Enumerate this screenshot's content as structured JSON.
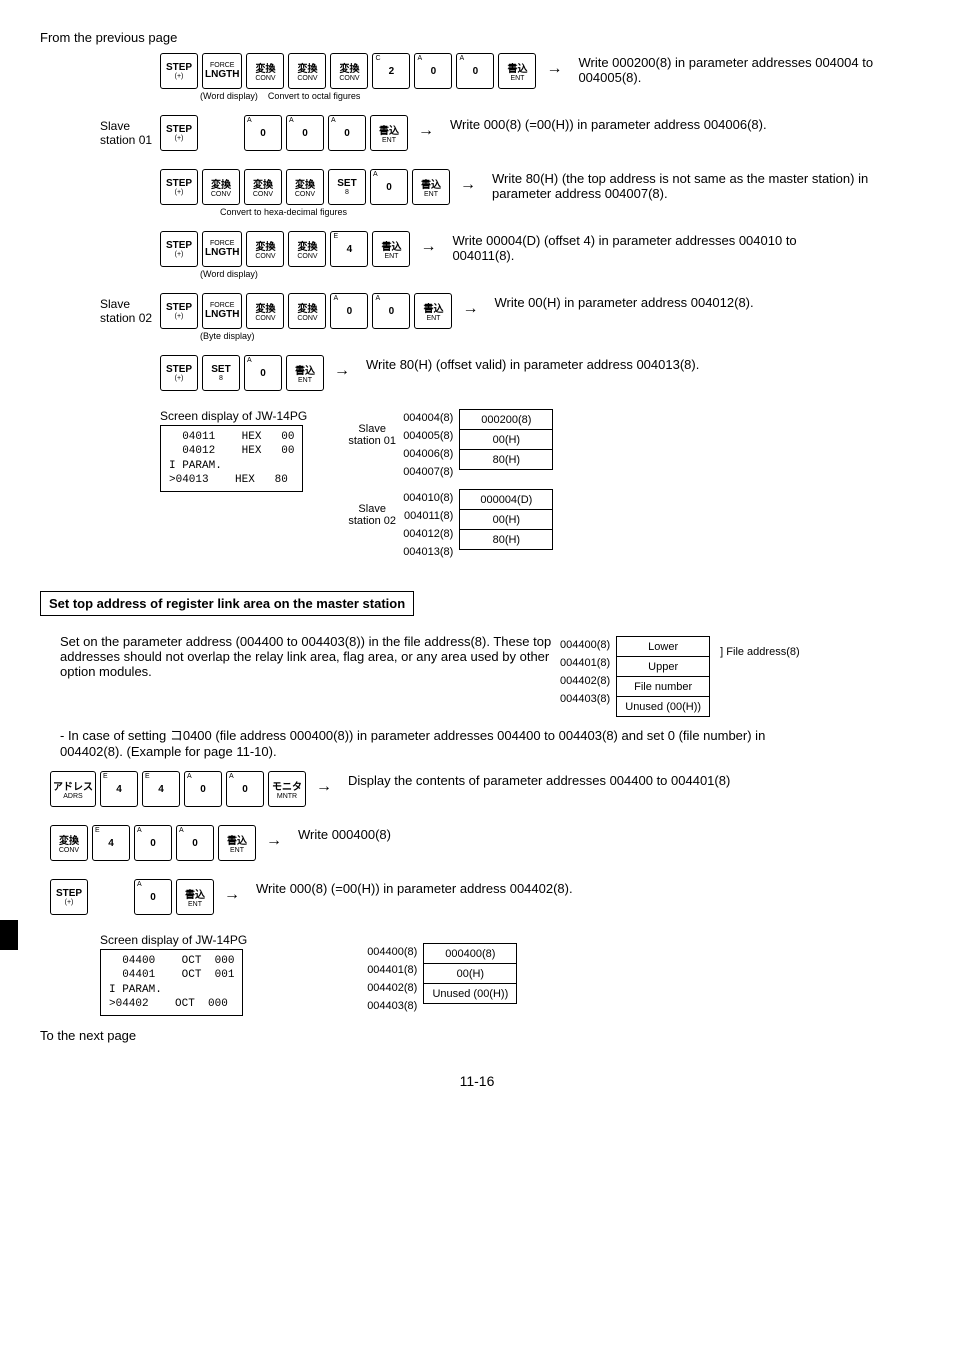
{
  "prev_page": "From the previous page",
  "next_page": "To the next page",
  "page_number": "11-16",
  "keys": {
    "step": {
      "top": "STEP",
      "bot": "(+)"
    },
    "lngth": {
      "top": "FORCE",
      "mid": "LNGTH"
    },
    "conv": {
      "top": "変換",
      "bot": "CONV"
    },
    "ent": {
      "top": "書込",
      "bot": "ENT"
    },
    "set8": {
      "top": "SET",
      "bot": "8"
    },
    "adrs": {
      "top": "アドレス",
      "bot": "ADRS"
    },
    "mntr": {
      "top": "モニタ",
      "bot": "MNTR"
    },
    "d0": {
      "sup": "A",
      "main": "0"
    },
    "d2": {
      "sup": "C",
      "main": "2"
    },
    "d4": {
      "sup": "E",
      "main": "4"
    }
  },
  "notes": {
    "word_display": "(Word display)",
    "byte_display": "(Byte display)",
    "convert_octal": "Convert to octal figures",
    "convert_hex": "Convert to hexa-decimal figures"
  },
  "side": {
    "slave01": "Slave station 01",
    "slave02": "Slave station 02"
  },
  "desc": {
    "l1": "Write 000200(8) in parameter addresses 004004 to 004005(8).",
    "l2": "Write 000(8) (=00(H)) in parameter address 004006(8).",
    "l3a": "Write 80(H) (the top address is not same as the master station) in parameter address 004007(8).",
    "l4": "Write 00004(D) (offset 4) in parameter addresses 004010 to 004011(8).",
    "l5": "Write 00(H) in parameter address 004012(8).",
    "l6": "Write 80(H) (offset valid) in parameter address 004013(8).",
    "disp_4400": "Display the contents of parameter addresses 004400 to 004401(8)",
    "write_000400": "Write 000400(8)",
    "write_000_4402": "Write 000(8) (=00(H)) in parameter address 004402(8)."
  },
  "screen1_title": "Screen display of JW-14PG",
  "screen1": "  04011    HEX   00\n  04012    HEX   00\nI PARAM.\n>04013    HEX   80",
  "screen2_title": "Screen display of JW-14PG",
  "screen2": "  04400    OCT  000\n  04401    OCT  001\nI PARAM.\n>04402    OCT  000",
  "mem": {
    "s1_addr": [
      "004004(8)",
      "004005(8)",
      "004006(8)",
      "004007(8)"
    ],
    "s1_val": [
      "000200(8)",
      "00(H)",
      "80(H)"
    ],
    "s2_addr": [
      "004010(8)",
      "004011(8)",
      "004012(8)",
      "004013(8)"
    ],
    "s2_val": [
      "000004(D)",
      "00(H)",
      "80(H)"
    ],
    "s1_label": "Slave station 01",
    "s2_label": "Slave station 02"
  },
  "section_header": "Set top address of register link area on the master station",
  "para1": "Set on the parameter address (004400 to 004403(8)) in the file address(8). These top addresses should not overlap the relay link area, flag area, or any area used by other option modules.",
  "para2": "- In case of setting コ0400 (file address 000400(8)) in parameter addresses 004400 to 004403(8) and set 0 (file number) in 004402(8). (Example for page 11-10).",
  "mem2": {
    "addr": [
      "004400(8)",
      "004401(8)",
      "004402(8)",
      "004403(8)"
    ],
    "labels": [
      "Lower",
      "Upper",
      "File number",
      "Unused (00(H))"
    ],
    "side": "File address(8)"
  },
  "mem3": {
    "addr": [
      "004400(8)",
      "004401(8)",
      "004402(8)",
      "004403(8)"
    ],
    "val": [
      "000400(8)",
      "00(H)",
      "Unused (00(H))"
    ]
  }
}
